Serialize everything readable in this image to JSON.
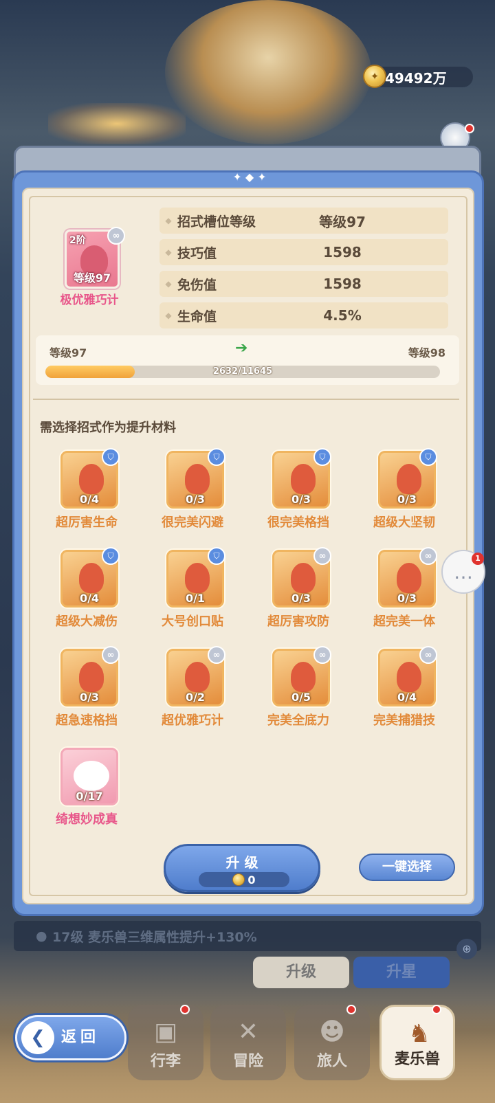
{
  "currency": {
    "amount": "49492万",
    "icon": "gold-coin-icon"
  },
  "skill": {
    "rank": "2阶",
    "level": "等级97",
    "name": "极优雅巧计"
  },
  "stats": [
    {
      "label": "招式槽位等级",
      "value": "等级97"
    },
    {
      "label": "技巧值",
      "value": "1598"
    },
    {
      "label": "免伤值",
      "value": "1598"
    },
    {
      "label": "生命值",
      "value": "4.5%"
    }
  ],
  "progress": {
    "from": "等级97",
    "to": "等级98",
    "text": "2632/11645",
    "current": 2632,
    "max": 11645
  },
  "materials_title": "需选择招式作为提升材料",
  "materials": [
    {
      "name": "超厉害生命",
      "count": "0/4",
      "badge": "shield"
    },
    {
      "name": "很完美闪避",
      "count": "0/3",
      "badge": "shield"
    },
    {
      "name": "很完美格挡",
      "count": "0/3",
      "badge": "shield"
    },
    {
      "name": "超级大坚韧",
      "count": "0/3",
      "badge": "shield"
    },
    {
      "name": "超级大减伤",
      "count": "0/4",
      "badge": "shield"
    },
    {
      "name": "大号创口贴",
      "count": "0/1",
      "badge": "shield"
    },
    {
      "name": "超厉害攻防",
      "count": "0/3",
      "badge": "link"
    },
    {
      "name": "超完美一体",
      "count": "0/3",
      "badge": "link"
    },
    {
      "name": "超急速格挡",
      "count": "0/3",
      "badge": "link"
    },
    {
      "name": "超优雅巧计",
      "count": "0/2",
      "badge": "link"
    },
    {
      "name": "完美全底力",
      "count": "0/5",
      "badge": "link"
    },
    {
      "name": "完美捕猎技",
      "count": "0/4",
      "badge": "link"
    },
    {
      "name": "绮想妙成真",
      "count": "0/17",
      "badge": "none"
    }
  ],
  "upgrade": {
    "label": "升 级",
    "cost": "0"
  },
  "quick_select": "一键选择",
  "chat_badge": "1",
  "info_strip": "17级  麦乐兽三维属性提升+130%",
  "ghost_buttons": [
    "升级",
    "升星"
  ],
  "back_label": "返回",
  "nav": [
    {
      "label": "行李",
      "icon": "luggage-icon"
    },
    {
      "label": "冒险",
      "icon": "swords-icon"
    },
    {
      "label": "旅人",
      "icon": "traveler-icon"
    },
    {
      "label": "麦乐兽",
      "icon": "fox-icon"
    }
  ],
  "colors": {
    "panel_blue": "#6e97d9",
    "accent_orange": "#e28a3a",
    "accent_pink": "#e8568a"
  }
}
